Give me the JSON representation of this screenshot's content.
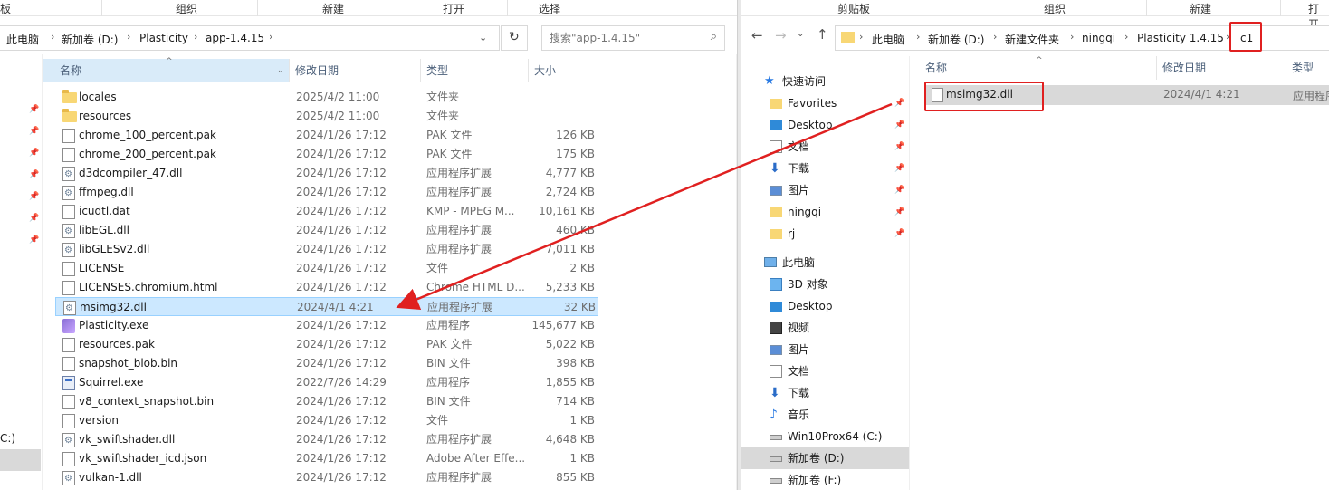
{
  "left_window": {
    "ribbon": [
      "板",
      "组织",
      "新建",
      "打开",
      "选择"
    ],
    "breadcrumb": [
      "此电脑",
      "新加卷 (D:)",
      "Plasticity",
      "app-1.4.15"
    ],
    "search_placeholder": "搜索\"app-1.4.15\"",
    "columns": {
      "name": "名称",
      "date": "修改日期",
      "type": "类型",
      "size": "大小"
    },
    "files": [
      {
        "name": "locales",
        "date": "2025/4/2 11:00",
        "type": "文件夹",
        "size": "",
        "icon": "folder"
      },
      {
        "name": "resources",
        "date": "2025/4/2 11:00",
        "type": "文件夹",
        "size": "",
        "icon": "folder"
      },
      {
        "name": "chrome_100_percent.pak",
        "date": "2024/1/26 17:12",
        "type": "PAK 文件",
        "size": "126 KB",
        "icon": "file"
      },
      {
        "name": "chrome_200_percent.pak",
        "date": "2024/1/26 17:12",
        "type": "PAK 文件",
        "size": "175 KB",
        "icon": "file"
      },
      {
        "name": "d3dcompiler_47.dll",
        "date": "2024/1/26 17:12",
        "type": "应用程序扩展",
        "size": "4,777 KB",
        "icon": "dll"
      },
      {
        "name": "ffmpeg.dll",
        "date": "2024/1/26 17:12",
        "type": "应用程序扩展",
        "size": "2,724 KB",
        "icon": "dll"
      },
      {
        "name": "icudtl.dat",
        "date": "2024/1/26 17:12",
        "type": "KMP - MPEG M...",
        "size": "10,161 KB",
        "icon": "file"
      },
      {
        "name": "libEGL.dll",
        "date": "2024/1/26 17:12",
        "type": "应用程序扩展",
        "size": "460 KB",
        "icon": "dll"
      },
      {
        "name": "libGLESv2.dll",
        "date": "2024/1/26 17:12",
        "type": "应用程序扩展",
        "size": "7,011 KB",
        "icon": "dll"
      },
      {
        "name": "LICENSE",
        "date": "2024/1/26 17:12",
        "type": "文件",
        "size": "2 KB",
        "icon": "file"
      },
      {
        "name": "LICENSES.chromium.html",
        "date": "2024/1/26 17:12",
        "type": "Chrome HTML D...",
        "size": "5,233 KB",
        "icon": "file"
      },
      {
        "name": "msimg32.dll",
        "date": "2024/4/1 4:21",
        "type": "应用程序扩展",
        "size": "32 KB",
        "icon": "dll",
        "selected": true
      },
      {
        "name": "Plasticity.exe",
        "date": "2024/1/26 17:12",
        "type": "应用程序",
        "size": "145,677 KB",
        "icon": "plast"
      },
      {
        "name": "resources.pak",
        "date": "2024/1/26 17:12",
        "type": "PAK 文件",
        "size": "5,022 KB",
        "icon": "file"
      },
      {
        "name": "snapshot_blob.bin",
        "date": "2024/1/26 17:12",
        "type": "BIN 文件",
        "size": "398 KB",
        "icon": "file"
      },
      {
        "name": "Squirrel.exe",
        "date": "2022/7/26 14:29",
        "type": "应用程序",
        "size": "1,855 KB",
        "icon": "exe"
      },
      {
        "name": "v8_context_snapshot.bin",
        "date": "2024/1/26 17:12",
        "type": "BIN 文件",
        "size": "714 KB",
        "icon": "file"
      },
      {
        "name": "version",
        "date": "2024/1/26 17:12",
        "type": "文件",
        "size": "1 KB",
        "icon": "file"
      },
      {
        "name": "vk_swiftshader.dll",
        "date": "2024/1/26 17:12",
        "type": "应用程序扩展",
        "size": "4,648 KB",
        "icon": "dll"
      },
      {
        "name": "vk_swiftshader_icd.json",
        "date": "2024/1/26 17:12",
        "type": "Adobe After Effe...",
        "size": "1 KB",
        "icon": "file"
      },
      {
        "name": "vulkan-1.dll",
        "date": "2024/1/26 17:12",
        "type": "应用程序扩展",
        "size": "855 KB",
        "icon": "dll"
      }
    ],
    "drive_fragment": "C:)"
  },
  "right_window": {
    "ribbon": [
      "剪贴板",
      "组织",
      "新建",
      "打开"
    ],
    "breadcrumb": [
      "此电脑",
      "新加卷 (D:)",
      "新建文件夹",
      "ningqi",
      "Plasticity 1.4.15",
      "c1"
    ],
    "columns": {
      "name": "名称",
      "date": "修改日期",
      "type": "类型"
    },
    "files": [
      {
        "name": "msimg32.dll",
        "date": "2024/4/1 4:21",
        "type": "应用程序扩"
      }
    ],
    "nav": [
      {
        "label": "快速访问",
        "icon": "star",
        "level": 0,
        "pinned": false
      },
      {
        "label": "Favorites",
        "icon": "folder",
        "level": 1,
        "pinned": true
      },
      {
        "label": "Desktop",
        "icon": "desktop",
        "level": 1,
        "pinned": true
      },
      {
        "label": "文档",
        "icon": "doc",
        "level": 1,
        "pinned": true
      },
      {
        "label": "下载",
        "icon": "download",
        "level": 1,
        "pinned": true
      },
      {
        "label": "图片",
        "icon": "picture",
        "level": 1,
        "pinned": true
      },
      {
        "label": "ningqi",
        "icon": "folder",
        "level": 1,
        "pinned": true
      },
      {
        "label": "rj",
        "icon": "folder",
        "level": 1,
        "pinned": true
      },
      {
        "label": "此电脑",
        "icon": "pc",
        "level": 0,
        "pinned": false,
        "gap": true
      },
      {
        "label": "3D 对象",
        "icon": "cube",
        "level": 1,
        "pinned": false
      },
      {
        "label": "Desktop",
        "icon": "desktop",
        "level": 1,
        "pinned": false
      },
      {
        "label": "视频",
        "icon": "video",
        "level": 1,
        "pinned": false
      },
      {
        "label": "图片",
        "icon": "picture",
        "level": 1,
        "pinned": false
      },
      {
        "label": "文档",
        "icon": "doc",
        "level": 1,
        "pinned": false
      },
      {
        "label": "下载",
        "icon": "download",
        "level": 1,
        "pinned": false
      },
      {
        "label": "音乐",
        "icon": "music",
        "level": 1,
        "pinned": false
      },
      {
        "label": "Win10Prox64 (C:)",
        "icon": "drive",
        "level": 1,
        "pinned": false
      },
      {
        "label": "新加卷 (D:)",
        "icon": "drive",
        "level": 1,
        "pinned": false,
        "selected": true
      },
      {
        "label": "新加卷 (F:)",
        "icon": "drive",
        "level": 1,
        "pinned": false
      }
    ]
  },
  "colors": {
    "annotation_red": "#e02020",
    "selection_blue": "#cce8ff",
    "header_text": "#4c607a"
  }
}
